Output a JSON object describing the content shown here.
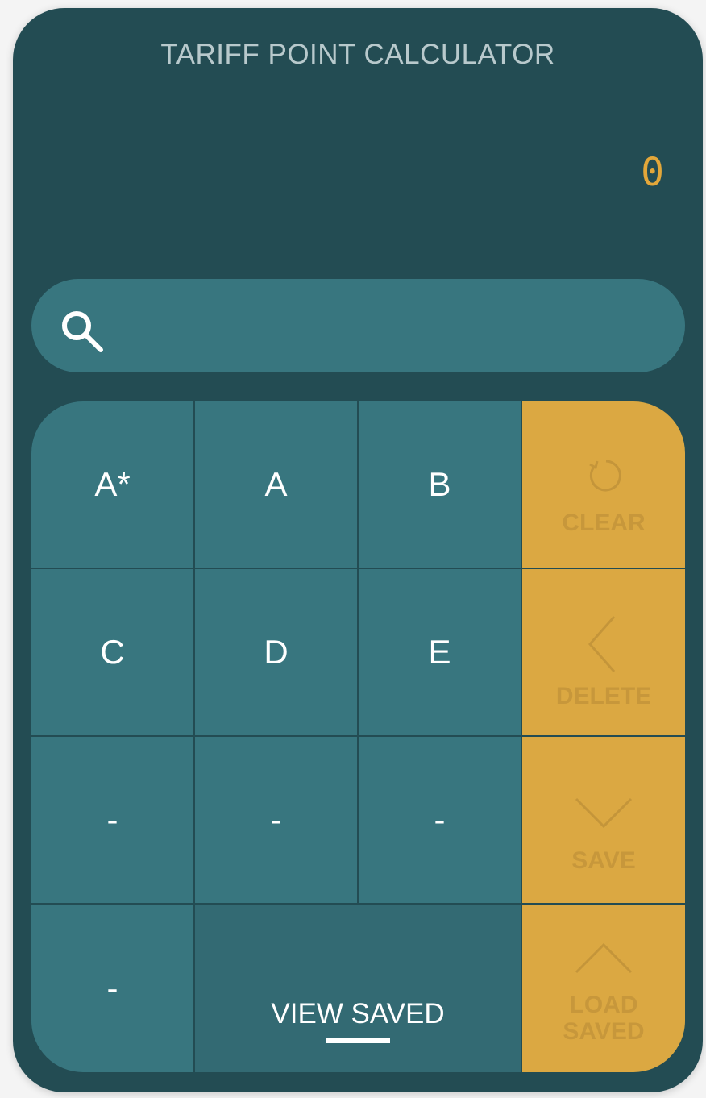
{
  "app": {
    "title": "TARIFF POINT CALCULATOR",
    "display_value": "0"
  },
  "search": {
    "placeholder": "",
    "value": ""
  },
  "grades": [
    {
      "label": "A*"
    },
    {
      "label": "A"
    },
    {
      "label": "B"
    },
    {
      "label": "C"
    },
    {
      "label": "D"
    },
    {
      "label": "E"
    },
    {
      "label": "-"
    },
    {
      "label": "-"
    },
    {
      "label": "-"
    },
    {
      "label": "-"
    }
  ],
  "actions": {
    "clear": "CLEAR",
    "delete": "DELETE",
    "save": "SAVE",
    "load_saved": "LOAD SAVED",
    "view_saved": "VIEW SAVED"
  },
  "colors": {
    "background": "#234c53",
    "key": "#38767f",
    "accent": "#dba842",
    "display": "#e3a73a"
  },
  "icons": {
    "search": "search-icon",
    "clear": "refresh-icon",
    "delete": "chevron-left-icon",
    "save": "chevron-down-icon",
    "load_saved": "chevron-up-icon"
  }
}
